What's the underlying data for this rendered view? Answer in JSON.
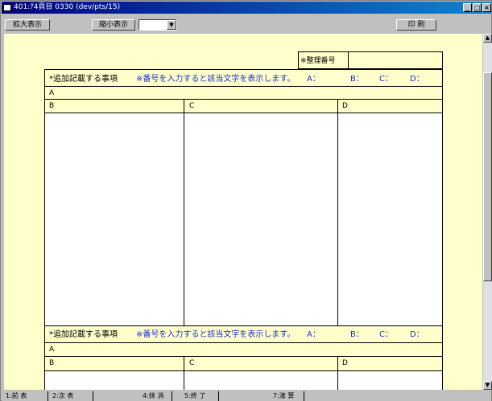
{
  "window": {
    "title": "401:ｱ4頁目 0330 (dev/pts/15)"
  },
  "toolbar": {
    "zoom_in": "拡大表示",
    "zoom_out": "縮小表示",
    "print": "印 刷"
  },
  "form": {
    "seiri_label": "※整理番号",
    "section_title": "*追加記載する事項",
    "section_hint": "※番号を入力すると該当文字を表示します。",
    "opt_a": "A：",
    "opt_b": "B：",
    "opt_c": "C：",
    "opt_d": "D：",
    "col_a": "A",
    "col_b": "B",
    "col_c": "C",
    "col_d": "D"
  },
  "fkeys": {
    "f1": "1:前 表",
    "f2": "2:次 表",
    "f4": "4:抹 消",
    "f5": "5:終 了",
    "f7": "7:演 算"
  }
}
